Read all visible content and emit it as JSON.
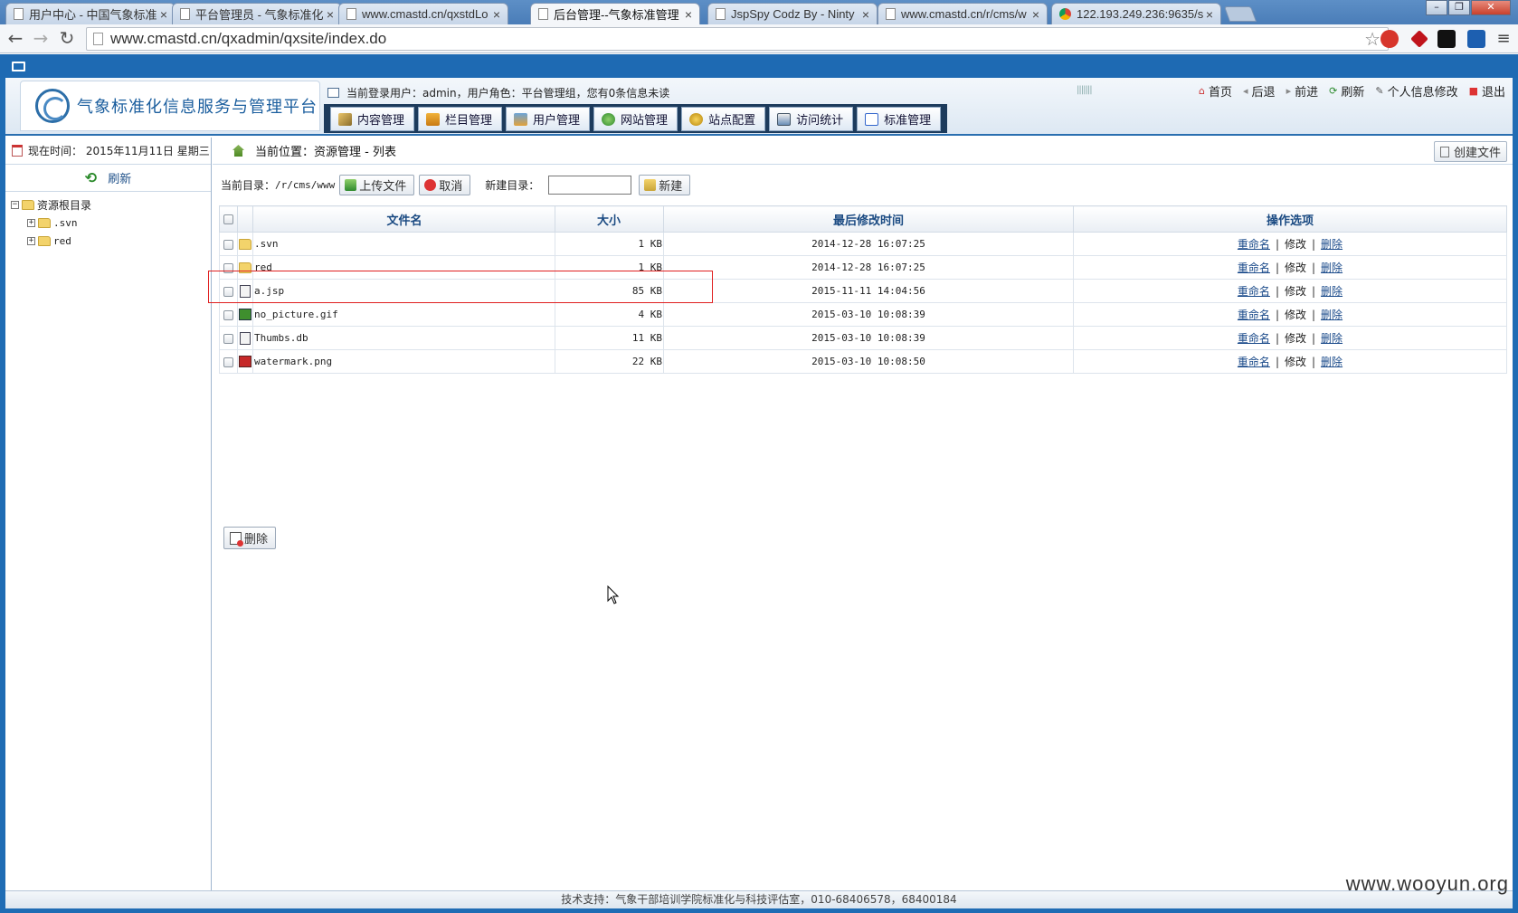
{
  "browser": {
    "tabs": [
      {
        "title": "用户中心 - 中国气象标准"
      },
      {
        "title": "平台管理员 - 气象标准化"
      },
      {
        "title": "www.cmastd.cn/qxstdLo"
      },
      {
        "title": "后台管理--气象标准管理"
      },
      {
        "title": "JspSpy Codz By - Ninty"
      },
      {
        "title": "www.cmastd.cn/r/cms/w"
      },
      {
        "title": "122.193.249.236:9635/s"
      }
    ],
    "url": "www.cmastd.cn/qxadmin/qxsite/index.do"
  },
  "header": {
    "logo_text": "气象标准化信息服务与管理平台",
    "user_info": "当前登录用户：admin，用户角色：平台管理组，您有0条信息未读",
    "quick_links": [
      "首页",
      "后退",
      "前进",
      "刷新",
      "个人信息修改",
      "退出"
    ],
    "menu": [
      "内容管理",
      "栏目管理",
      "用户管理",
      "网站管理",
      "站点配置",
      "访问统计",
      "标准管理"
    ]
  },
  "sidebar": {
    "date": "现在时间： 2015年11月11日 星期三",
    "refresh": "刷新",
    "tree_root": "资源根目录",
    "tree_children": [
      ".svn",
      "red"
    ]
  },
  "main": {
    "breadcrumb": "当前位置：资源管理 - 列表",
    "create_file": "创建文件",
    "current_dir_label": "当前目录：",
    "current_dir": "/r/cms/www",
    "upload": "上传文件",
    "cancel": "取消",
    "newdir_label": "新建目录：",
    "newdir_value": "",
    "new_button": "新建",
    "columns": [
      "文件名",
      "大小",
      "最后修改时间",
      "操作选项"
    ],
    "files": [
      {
        "name": ".svn",
        "size": "1 KB",
        "modified": "2014-12-28 16:07:25",
        "type": "dir"
      },
      {
        "name": "red",
        "size": "1 KB",
        "modified": "2014-12-28 16:07:25",
        "type": "dir"
      },
      {
        "name": "a.jsp",
        "size": "85 KB",
        "modified": "2015-11-11 14:04:56",
        "type": "jsp"
      },
      {
        "name": "no_picture.gif",
        "size": "4 KB",
        "modified": "2015-03-10 10:08:39",
        "type": "gif"
      },
      {
        "name": "Thumbs.db",
        "size": "11 KB",
        "modified": "2015-03-10 10:08:39",
        "type": "db"
      },
      {
        "name": "watermark.png",
        "size": "22 KB",
        "modified": "2015-03-10 10:08:50",
        "type": "png"
      }
    ],
    "ops": {
      "rename": "重命名",
      "edit": "修改",
      "delete": "删除"
    },
    "delete_button": "删除"
  },
  "footer": "技术支持：气象干部培训学院标准化与科技评估室，010-68406578，68400184",
  "watermark": "www.wooyun.org"
}
